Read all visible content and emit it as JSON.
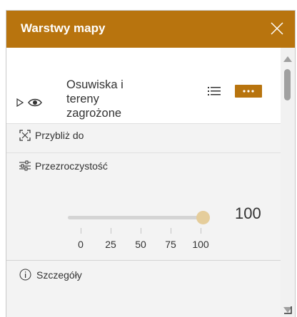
{
  "header": {
    "title": "Warstwy mapy",
    "close_icon": "close-icon",
    "background": "#b8740e"
  },
  "layer": {
    "name": "Osuwiska i tereny zagrożone",
    "name_lines": [
      "Osuwiska i",
      "tereny",
      "zagrożone"
    ],
    "expand_icon": "caret-right-icon",
    "visibility_icon": "eye-icon",
    "legend_icon": "legend-list-icon",
    "options_icon": "ellipsis-icon"
  },
  "actions": {
    "zoom_to": {
      "label": "Przybliż do",
      "icon": "zoom-extent-icon"
    },
    "transparency": {
      "label": "Przezroczystość",
      "icon": "sliders-icon",
      "value": 100,
      "value_label": "100",
      "min": 0,
      "max": 100,
      "ticks": [
        "0",
        "25",
        "50",
        "75",
        "100"
      ]
    },
    "details": {
      "label": "Szczegóły",
      "icon": "info-icon"
    }
  },
  "scrollbar": {
    "up_icon": "scroll-up-icon",
    "down_icon": "scroll-down-icon"
  },
  "colors": {
    "accent": "#b8740e",
    "slider_thumb": "#e5cd9b",
    "track": "#d4d4d4",
    "panel_bg": "#f3f3f3"
  }
}
